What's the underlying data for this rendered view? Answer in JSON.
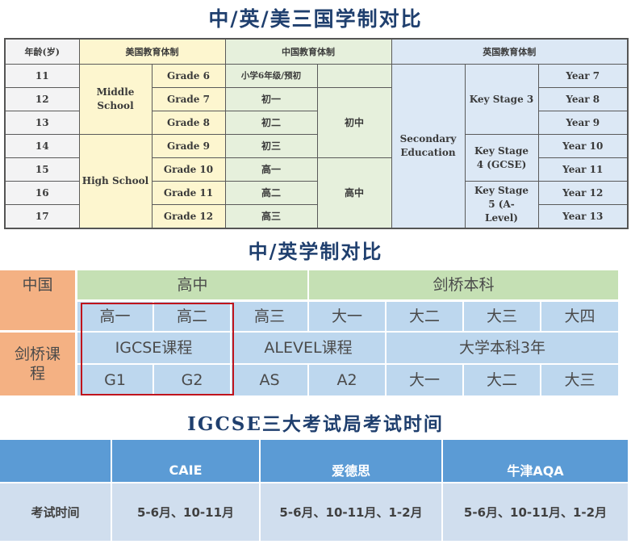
{
  "titles": {
    "main": "中/英/美三国学制对比",
    "cn_uk": "中/英学制对比",
    "igcse": "IGCSE三大考试局考试时间"
  },
  "comparison_table": {
    "headers": {
      "age": "年龄(岁)",
      "us": "美国教育体制",
      "cn": "中国教育体制",
      "uk": "英国教育体制"
    },
    "ages": [
      "11",
      "12",
      "13",
      "14",
      "15",
      "16",
      "17"
    ],
    "us_schools": [
      "Middle School",
      "High School"
    ],
    "us_grades": [
      "Grade 6",
      "Grade 7",
      "Grade 8",
      "Grade 9",
      "Grade 10",
      "Grade 11",
      "Grade 12"
    ],
    "cn_grades": [
      "小学6年级/预初",
      "初一",
      "初二",
      "初三",
      "高一",
      "高二",
      "高三"
    ],
    "cn_stages": [
      "",
      "初中",
      "高中"
    ],
    "uk_level": "Secondary Education",
    "uk_key_stages": [
      "Key Stage 3",
      "Key Stage 4 (GCSE)",
      "Key Stage 5 (A- Level)"
    ],
    "uk_years": [
      "Year 7",
      "Year 8",
      "Year 9",
      "Year 10",
      "Year 11",
      "Year 12",
      "Year 13"
    ]
  },
  "cn_uk_table": {
    "row_labels": {
      "china": "中国",
      "cambridge": "剑桥课程"
    },
    "stages": [
      "高中",
      "剑桥本科"
    ],
    "china_years": [
      "高一",
      "高二",
      "高三",
      "大一",
      "大二",
      "大三",
      "大四"
    ],
    "courses": [
      "IGCSE课程",
      "ALEVEL课程",
      "大学本科3年"
    ],
    "cambridge_years": [
      "G1",
      "G2",
      "AS",
      "A2",
      "大一",
      "大二",
      "大三"
    ],
    "highlight_color": "#c0141c"
  },
  "exam_table": {
    "boards": [
      "CAIE",
      "爱德思",
      "牛津AQA"
    ],
    "row_label": "考试时间",
    "times": [
      "5-6月、10-11月",
      "5-6月、10-11月、1-2月",
      "5-6月、10-11月、1-2月"
    ]
  },
  "colors": {
    "title": "#1f3f6e",
    "us": "#fdf6cf",
    "cn": "#e6f0dc",
    "uk": "#dce8f5",
    "orange": "#f4b183",
    "green": "#c5e0b4",
    "blue": "#bdd7ee",
    "header_blue": "#5b9bd5"
  }
}
